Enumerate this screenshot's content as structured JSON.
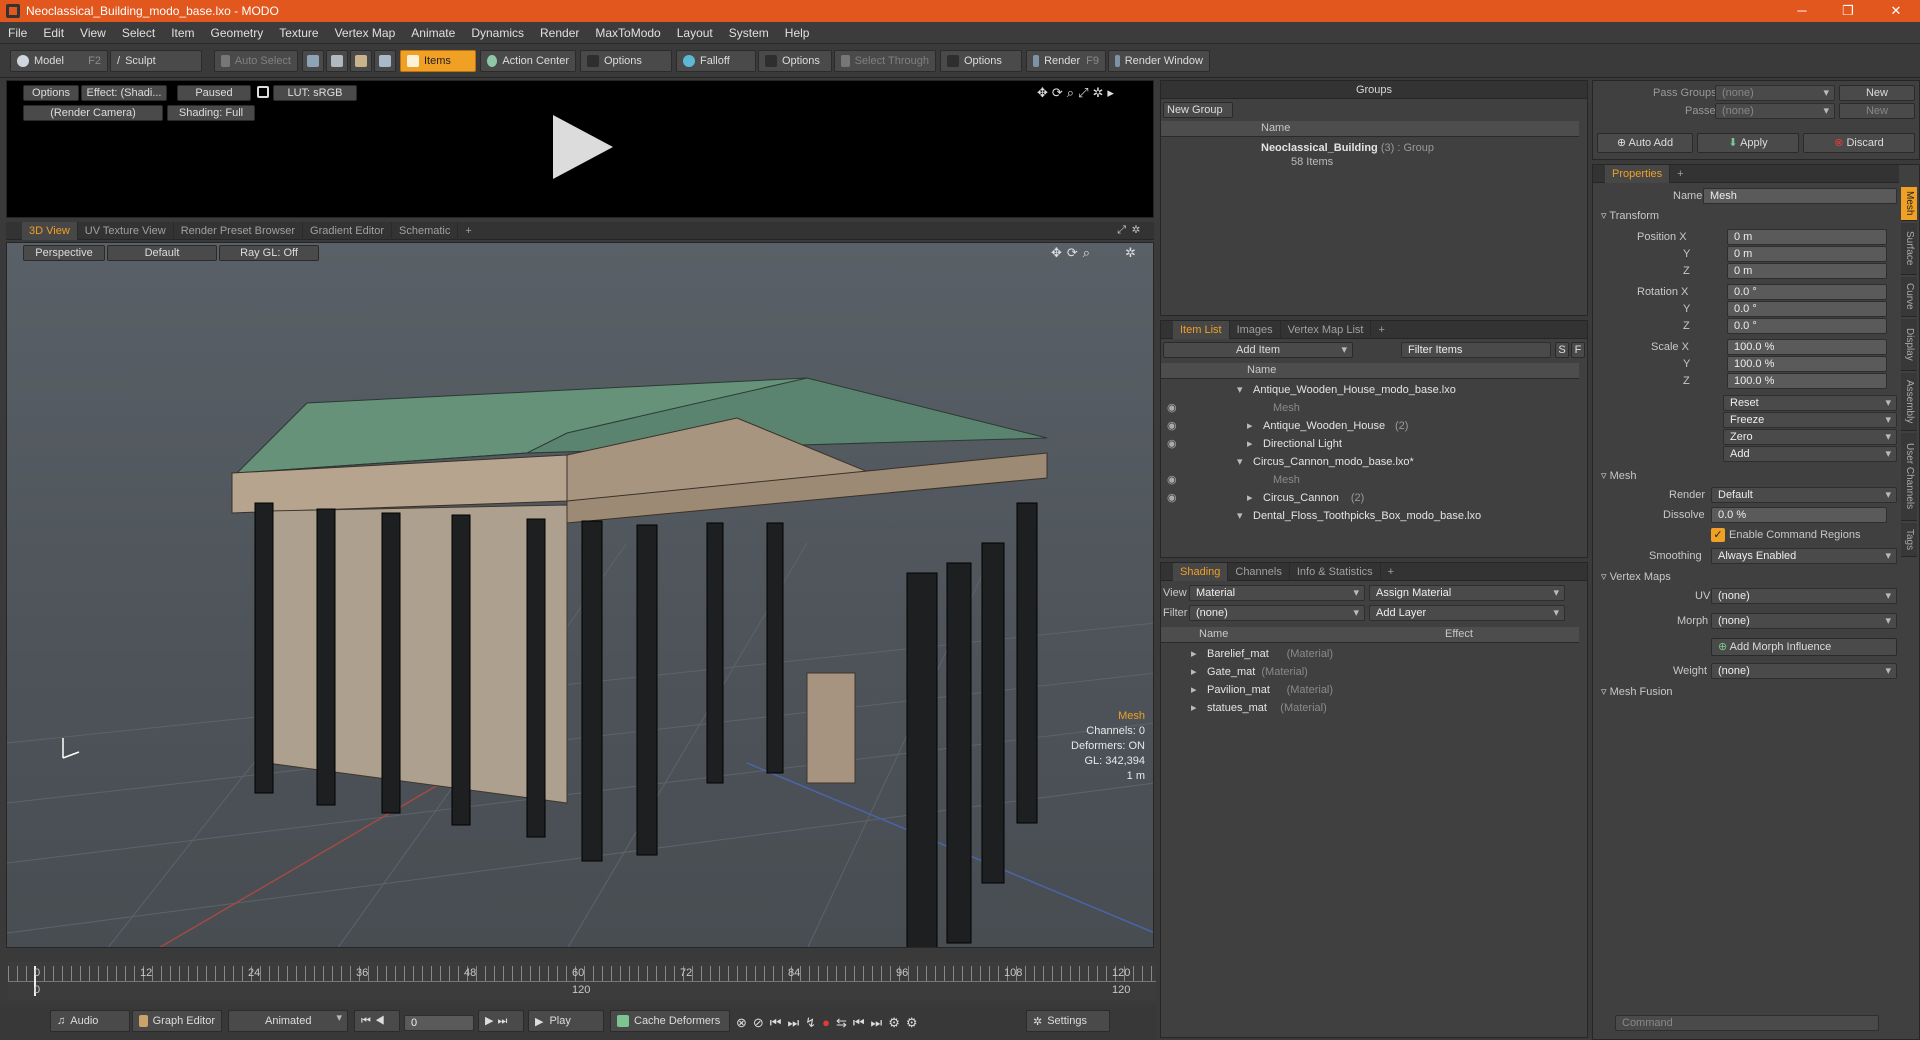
{
  "window": {
    "title": "Neoclassical_Building_modo_base.lxo - MODO",
    "controls": [
      "─",
      "❐",
      "✕"
    ]
  },
  "menu": [
    "File",
    "Edit",
    "View",
    "Select",
    "Item",
    "Geometry",
    "Texture",
    "Vertex Map",
    "Animate",
    "Dynamics",
    "Render",
    "MaxToModo",
    "Layout",
    "System",
    "Help"
  ],
  "toolbar": {
    "model": "Model",
    "model_key": "F2",
    "sculpt": "Sculpt",
    "auto_select": "Auto Select",
    "items": "Items",
    "action_center": "Action Center",
    "options1": "Options",
    "falloff": "Falloff",
    "options2": "Options",
    "select_through": "Select Through",
    "options3": "Options",
    "render": "Render",
    "render_key": "F9",
    "render_window": "Render Window"
  },
  "render_panel": {
    "options": "Options",
    "effect": "Effect: (Shadi...",
    "paused": "Paused",
    "lut": "LUT: sRGB",
    "camera": "(Render Camera)",
    "shading": "Shading: Full"
  },
  "viewport_tabs": [
    "3D View",
    "UV Texture View",
    "Render Preset Browser",
    "Gradient Editor",
    "Schematic",
    "+"
  ],
  "viewport": {
    "projection": "Perspective",
    "style": "Default",
    "raygl": "Ray GL: Off",
    "info": {
      "title": "Mesh",
      "channels": "Channels: 0",
      "deformers": "Deformers: ON",
      "gl": "GL: 342,394",
      "scale": "1 m"
    }
  },
  "groups": {
    "title": "Groups",
    "new_group": "New Group",
    "col_name": "Name",
    "row_name": "Neoclassical_Building",
    "row_count": "(3)",
    "row_type": ": Group",
    "row_items": "58 Items"
  },
  "itemlist": {
    "tabs": [
      "Item List",
      "Images",
      "Vertex Map List",
      "+"
    ],
    "add_item": "Add Item",
    "filter": "Filter Items",
    "s": "S",
    "f": "F",
    "col_name": "Name",
    "rows": [
      {
        "text": "Antique_Wooden_House_modo_base.lxo",
        "indent": 0,
        "dim": false
      },
      {
        "text": "Mesh",
        "indent": 2,
        "dim": true
      },
      {
        "text": "Antique_Wooden_House",
        "suffix": "(2)",
        "indent": 1,
        "dim": false
      },
      {
        "text": "Directional Light",
        "indent": 1,
        "dim": false
      },
      {
        "text": "Circus_Cannon_modo_base.lxo*",
        "indent": 0,
        "dim": false
      },
      {
        "text": "Mesh",
        "indent": 2,
        "dim": true
      },
      {
        "text": "Circus_Cannon",
        "suffix": "(2)",
        "indent": 1,
        "dim": false
      },
      {
        "text": "Dental_Floss_Toothpicks_Box_modo_base.lxo",
        "indent": 0,
        "dim": false
      }
    ]
  },
  "shading": {
    "tabs": [
      "Shading",
      "Channels",
      "Info & Statistics",
      "+"
    ],
    "view_label": "View",
    "view_value": "Material",
    "assign": "Assign Material",
    "filter_label": "Filter",
    "filter_value": "(none)",
    "add_layer": "Add Layer",
    "col_name": "Name",
    "col_effect": "Effect",
    "rows": [
      {
        "name": "Barelief_mat",
        "type": "(Material)"
      },
      {
        "name": "Gate_mat",
        "type": "(Material)"
      },
      {
        "name": "Pavilion_mat",
        "type": "(Material)"
      },
      {
        "name": "statues_mat",
        "type": "(Material)"
      }
    ]
  },
  "passes": {
    "pass_groups": "Pass Groups",
    "passes": "Passes",
    "none": "(none)",
    "new": "New",
    "auto_add": "Auto Add",
    "apply": "Apply",
    "discard": "Discard"
  },
  "properties": {
    "tab": "Properties",
    "name_label": "Name",
    "name_value": "Mesh",
    "transform": "Transform",
    "position_x": "Position X",
    "y": "Y",
    "z": "Z",
    "rotation_x": "Rotation X",
    "scale_x": "Scale X",
    "pos": [
      "0 m",
      "0 m",
      "0 m"
    ],
    "rot": [
      "0.0 °",
      "0.0 °",
      "0.0 °"
    ],
    "scl": [
      "100.0 %",
      "100.0 %",
      "100.0 %"
    ],
    "reset": "Reset",
    "freeze": "Freeze",
    "zero": "Zero",
    "add": "Add",
    "mesh": "Mesh",
    "render_label": "Render",
    "render_value": "Default",
    "dissolve_label": "Dissolve",
    "dissolve_value": "0.0 %",
    "enable_cmd": "Enable Command Regions",
    "smoothing_label": "Smoothing",
    "smoothing_value": "Always Enabled",
    "vertex_maps": "Vertex Maps",
    "uv_label": "UV",
    "uv_value": "(none)",
    "morph_label": "Morph",
    "morph_value": "(none)",
    "add_morph": "Add Morph Influence",
    "weight_label": "Weight",
    "weight_value": "(none)",
    "mesh_fusion": "Mesh Fusion",
    "side_tabs": [
      "Mesh",
      "Surface",
      "Curve",
      "Display",
      "Assembly",
      "User Channels",
      "Tags"
    ],
    "command": "Command"
  },
  "timeline": {
    "ticks": [
      "0",
      "12",
      "24",
      "36",
      "48",
      "60",
      "72",
      "84",
      "96",
      "108",
      "120"
    ],
    "sub": [
      "0",
      "120",
      "120"
    ]
  },
  "bottombar": {
    "audio": "Audio",
    "graph_editor": "Graph Editor",
    "animated": "Animated",
    "frame": "0",
    "play": "Play",
    "cache": "Cache Deformers",
    "settings": "Settings"
  },
  "colors": {
    "accent": "#f0a024",
    "title_bar": "#e2571e",
    "roof": "#5f8f73"
  }
}
